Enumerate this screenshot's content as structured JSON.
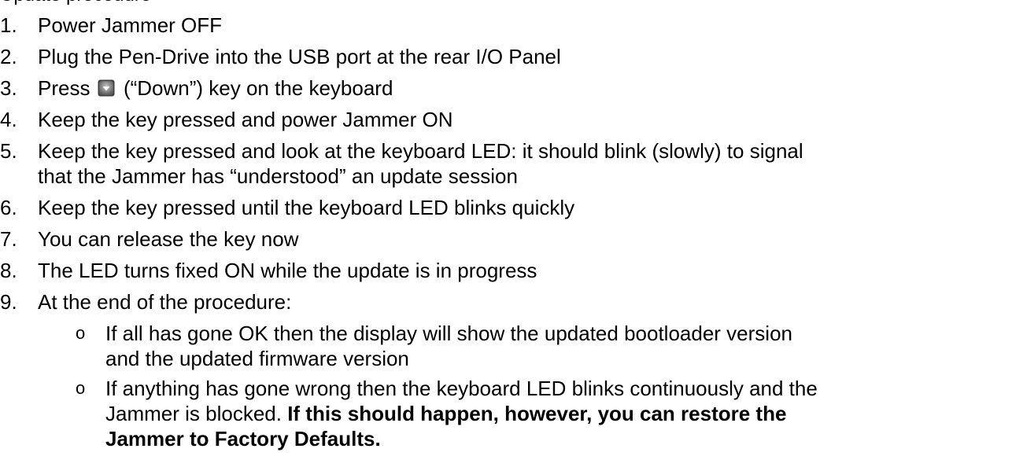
{
  "intro": "Update procedure",
  "steps": [
    {
      "num": "1.",
      "text": "Power Jammer OFF"
    },
    {
      "num": "2.",
      "text": "Plug the Pen-Drive into the USB port at the rear I/O Panel"
    },
    {
      "num": "3.",
      "before": "Press",
      "icon": "down-key-icon",
      "after": "(“Down”) key on the keyboard"
    },
    {
      "num": "4.",
      "text": "Keep the key pressed and power Jammer ON"
    },
    {
      "num": "5.",
      "line1": "Keep the key pressed and look at the keyboard LED: it should blink (slowly) to signal",
      "line2": "that the Jammer has “understood” an update session"
    },
    {
      "num": "6.",
      "text": "Keep the key pressed until the keyboard LED blinks quickly"
    },
    {
      "num": "7.",
      "text": "You can release the key now"
    },
    {
      "num": "8.",
      "text": "The LED turns fixed ON while the update is in progress"
    },
    {
      "num": "9.",
      "text": "At the end of the procedure:"
    }
  ],
  "sub_bullets": [
    {
      "bullet": "o",
      "line1": "If all has gone OK then the display will show the updated bootloader version",
      "line2": "and the updated firmware version"
    },
    {
      "bullet": "o",
      "line1": "If anything has gone wrong then the keyboard LED blinks continuously and the",
      "line2_plain": "Jammer is blocked. ",
      "line2_bold": "If this should happen, however, you can restore the",
      "line3_bold": "Jammer to Factory Defaults."
    }
  ],
  "colors": {
    "text": "#000000",
    "key_icon_outer": "#5a5a5a",
    "key_icon_inner": "#9a9a9a"
  }
}
